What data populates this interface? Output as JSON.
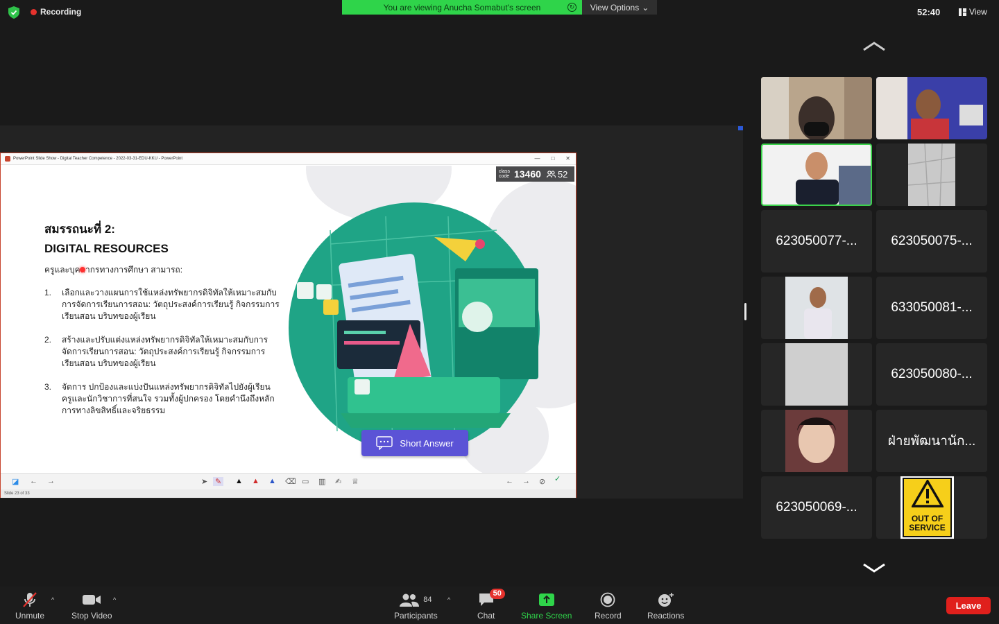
{
  "top": {
    "recording": "Recording",
    "banner": "You are viewing Anucha Somabut's screen",
    "view_options": "View Options",
    "timer": "52:40",
    "view": "View"
  },
  "ppt": {
    "window_title": "PowerPoint Slide Show  -  Digital Teacher Competence - 2022-03-31-EDU-KKU  -  PowerPoint",
    "status": "Slide 23 of 33",
    "class_code_label": "class code",
    "class_code": "13460",
    "participants_count": "52"
  },
  "slide": {
    "heading": "สมรรถนะที่ 2:",
    "subheading": "DIGITAL RESOURCES",
    "intro": "ครูและบุคลากรทางการศึกษา สามารถ:",
    "items": [
      {
        "num": "1.",
        "text": "เลือกและวางแผนการใช้แหล่งทรัพยากรดิจิทัลให้เหมาะสมกับการจัดการเรียนการสอน: วัตถุประสงค์การเรียนรู้ กิจกรรมการเรียนสอน บริบทของผู้เรียน"
      },
      {
        "num": "2.",
        "text": "สร้างและปรับแต่งแหล่งทรัพยากรดิจิทัลให้เหมาะสมกับการจัดการเรียนการสอน: วัตถุประสงค์การเรียนรู้ กิจกรรมการเรียนสอน บริบทของผู้เรียน"
      },
      {
        "num": "3.",
        "text": "จัดการ ปกป้องและแบ่งปันแหล่งทรัพยากรดิจิทัลไปยังผู้เรียน ครูและนักวิชาการที่สนใจ รวมทั้งผู้ปกครอง โดยคำนึงถึงหลักการทางลิขสิทธิ์และจริยธรรม"
      }
    ],
    "short_answer": "Short Answer"
  },
  "gallery": {
    "names": [
      "623050077-...",
      "623050075-...",
      "633050081-...",
      "623050080-...",
      "ฝ่ายพัฒนานัก...",
      "623050069-..."
    ],
    "out_of_service_line1": "OUT OF",
    "out_of_service_line2": "SERVICE"
  },
  "bottom": {
    "unmute": "Unmute",
    "stop_video": "Stop Video",
    "participants": "Participants",
    "participants_count": "84",
    "chat": "Chat",
    "chat_badge": "50",
    "share_screen": "Share Screen",
    "record": "Record",
    "reactions": "Reactions",
    "leave": "Leave"
  },
  "colors": {
    "share_green": "#2fd44a",
    "leave_red": "#e0201c",
    "short_answer": "#5b53d6",
    "illustration_teal": "#1fa486"
  }
}
